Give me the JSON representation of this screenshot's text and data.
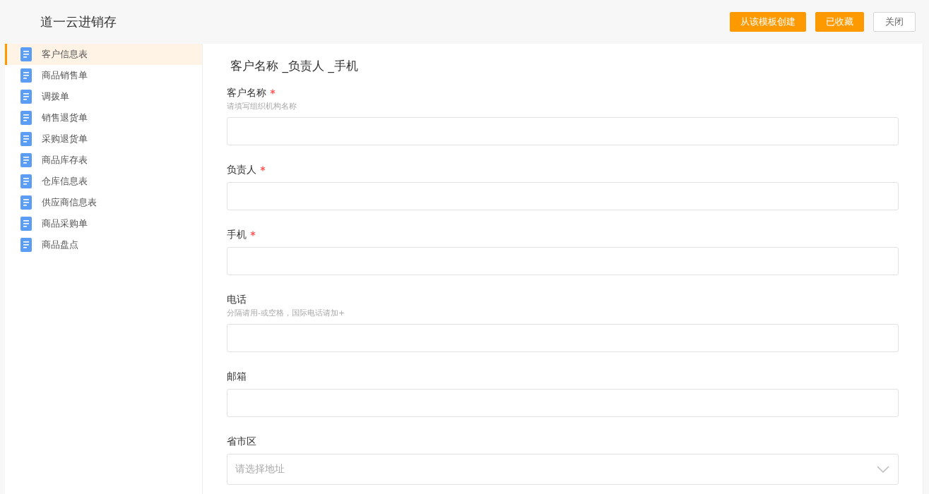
{
  "header": {
    "title": "道一云进销存",
    "buttons": [
      {
        "label": "从该模板创建",
        "kind": "primary"
      },
      {
        "label": "已收藏",
        "kind": "primary"
      },
      {
        "label": "关闭",
        "kind": "default"
      }
    ]
  },
  "sidebar": {
    "items": [
      {
        "label": "客户信息表",
        "selected": true
      },
      {
        "label": "商品销售单",
        "selected": false
      },
      {
        "label": "调拨单",
        "selected": false
      },
      {
        "label": "销售退货单",
        "selected": false
      },
      {
        "label": "采购退货单",
        "selected": false
      },
      {
        "label": "商品库存表",
        "selected": false
      },
      {
        "label": "仓库信息表",
        "selected": false
      },
      {
        "label": "供应商信息表",
        "selected": false
      },
      {
        "label": "商品采购单",
        "selected": false
      },
      {
        "label": "商品盘点",
        "selected": false
      }
    ]
  },
  "form": {
    "title": "客户名称 _负责人 _手机",
    "fields": [
      {
        "label": "客户名称",
        "required": true,
        "hint": "请填写组织机构名称",
        "kind": "text"
      },
      {
        "label": "负责人",
        "required": true,
        "kind": "text"
      },
      {
        "label": "手机",
        "required": true,
        "kind": "text"
      },
      {
        "label": "电话",
        "required": false,
        "hint": "分隔请用-或空格，国际电话请加+",
        "kind": "text"
      },
      {
        "label": "邮箱",
        "required": false,
        "kind": "text"
      },
      {
        "label": "省市区",
        "required": false,
        "kind": "select",
        "placeholder": "请选择地址"
      }
    ]
  }
}
